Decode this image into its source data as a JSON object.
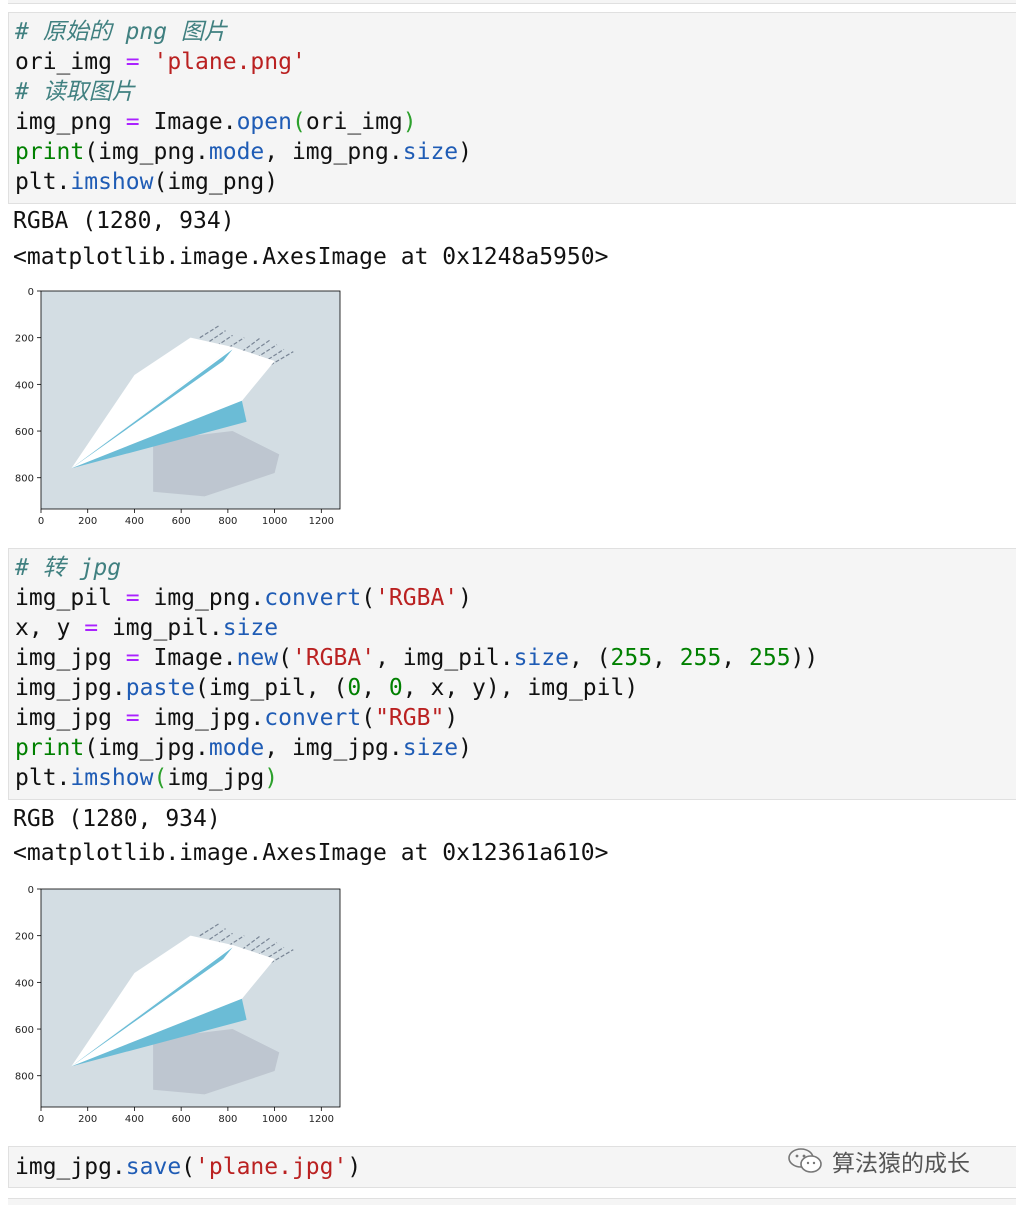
{
  "cell1": {
    "lines": [
      "# 原始的 png 图片",
      "ori_img = 'plane.png'",
      "# 读取图片",
      "img_png = Image.open(ori_img)",
      "print(img_png.mode, img_png.size)",
      "plt.imshow(img_png)"
    ],
    "output_text": "RGBA (1280, 934)",
    "output_repr": "<matplotlib.image.AxesImage at 0x1248a5950>"
  },
  "cell2": {
    "lines": [
      "# 转 jpg",
      "img_pil = img_png.convert('RGBA')",
      "x, y = img_pil.size",
      "img_jpg = Image.new('RGBA', img_pil.size, (255, 255, 255))",
      "img_jpg.paste(img_pil, (0, 0, x, y), img_pil)",
      "img_jpg = img_jpg.convert(\"RGB\")",
      "print(img_jpg.mode, img_jpg.size)",
      "plt.imshow(img_jpg)"
    ],
    "output_text": "RGB (1280, 934)",
    "output_repr": "<matplotlib.image.AxesImage at 0x12361a610>"
  },
  "cell3": {
    "lines": [
      "img_jpg.save('plane.jpg')"
    ]
  },
  "plot": {
    "xticks": [
      "0",
      "200",
      "400",
      "600",
      "800",
      "1000",
      "1200"
    ],
    "yticks": [
      "0",
      "200",
      "400",
      "600",
      "800"
    ],
    "background_color": "#d3dde3",
    "plane_color": "#ffffff",
    "accent_color": "#6bbcd6",
    "shadow_color": "#b9c1cb"
  },
  "watermark": {
    "label": "算法猿的成长",
    "icon": "wechat-icon"
  }
}
